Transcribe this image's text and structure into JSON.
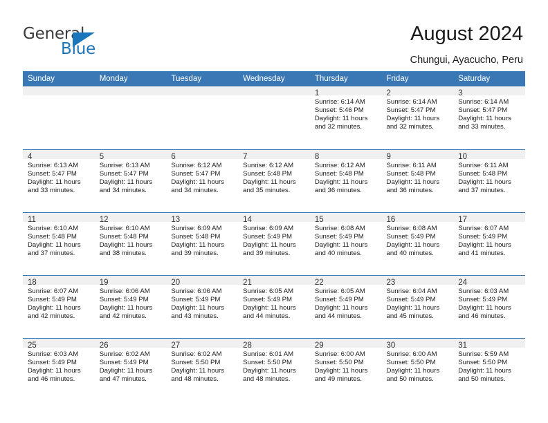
{
  "brand": {
    "name_part1": "General",
    "name_part2": "Blue"
  },
  "header": {
    "title": "August 2024",
    "location": "Chungui, Ayacucho, Peru"
  },
  "calendar": {
    "weekday_headers": [
      "Sunday",
      "Monday",
      "Tuesday",
      "Wednesday",
      "Thursday",
      "Friday",
      "Saturday"
    ],
    "colors": {
      "header_background": "#3a78b5",
      "header_text": "#ffffff",
      "daynum_background": "#f0f0f0",
      "row_border": "#3a78b5",
      "brand_blue": "#1b75bb"
    },
    "labels": {
      "sunrise": "Sunrise:",
      "sunset": "Sunset:",
      "daylight": "Daylight:"
    },
    "weeks": [
      [
        {
          "day": "",
          "empty": true
        },
        {
          "day": "",
          "empty": true
        },
        {
          "day": "",
          "empty": true
        },
        {
          "day": "",
          "empty": true
        },
        {
          "day": "1",
          "sunrise": "Sunrise: 6:14 AM",
          "sunset": "Sunset: 5:46 PM",
          "daylight": "Daylight: 11 hours and 32 minutes."
        },
        {
          "day": "2",
          "sunrise": "Sunrise: 6:14 AM",
          "sunset": "Sunset: 5:47 PM",
          "daylight": "Daylight: 11 hours and 32 minutes."
        },
        {
          "day": "3",
          "sunrise": "Sunrise: 6:14 AM",
          "sunset": "Sunset: 5:47 PM",
          "daylight": "Daylight: 11 hours and 33 minutes."
        }
      ],
      [
        {
          "day": "4",
          "sunrise": "Sunrise: 6:13 AM",
          "sunset": "Sunset: 5:47 PM",
          "daylight": "Daylight: 11 hours and 33 minutes."
        },
        {
          "day": "5",
          "sunrise": "Sunrise: 6:13 AM",
          "sunset": "Sunset: 5:47 PM",
          "daylight": "Daylight: 11 hours and 34 minutes."
        },
        {
          "day": "6",
          "sunrise": "Sunrise: 6:12 AM",
          "sunset": "Sunset: 5:47 PM",
          "daylight": "Daylight: 11 hours and 34 minutes."
        },
        {
          "day": "7",
          "sunrise": "Sunrise: 6:12 AM",
          "sunset": "Sunset: 5:48 PM",
          "daylight": "Daylight: 11 hours and 35 minutes."
        },
        {
          "day": "8",
          "sunrise": "Sunrise: 6:12 AM",
          "sunset": "Sunset: 5:48 PM",
          "daylight": "Daylight: 11 hours and 36 minutes."
        },
        {
          "day": "9",
          "sunrise": "Sunrise: 6:11 AM",
          "sunset": "Sunset: 5:48 PM",
          "daylight": "Daylight: 11 hours and 36 minutes."
        },
        {
          "day": "10",
          "sunrise": "Sunrise: 6:11 AM",
          "sunset": "Sunset: 5:48 PM",
          "daylight": "Daylight: 11 hours and 37 minutes."
        }
      ],
      [
        {
          "day": "11",
          "sunrise": "Sunrise: 6:10 AM",
          "sunset": "Sunset: 5:48 PM",
          "daylight": "Daylight: 11 hours and 37 minutes."
        },
        {
          "day": "12",
          "sunrise": "Sunrise: 6:10 AM",
          "sunset": "Sunset: 5:48 PM",
          "daylight": "Daylight: 11 hours and 38 minutes."
        },
        {
          "day": "13",
          "sunrise": "Sunrise: 6:09 AM",
          "sunset": "Sunset: 5:48 PM",
          "daylight": "Daylight: 11 hours and 39 minutes."
        },
        {
          "day": "14",
          "sunrise": "Sunrise: 6:09 AM",
          "sunset": "Sunset: 5:49 PM",
          "daylight": "Daylight: 11 hours and 39 minutes."
        },
        {
          "day": "15",
          "sunrise": "Sunrise: 6:08 AM",
          "sunset": "Sunset: 5:49 PM",
          "daylight": "Daylight: 11 hours and 40 minutes."
        },
        {
          "day": "16",
          "sunrise": "Sunrise: 6:08 AM",
          "sunset": "Sunset: 5:49 PM",
          "daylight": "Daylight: 11 hours and 40 minutes."
        },
        {
          "day": "17",
          "sunrise": "Sunrise: 6:07 AM",
          "sunset": "Sunset: 5:49 PM",
          "daylight": "Daylight: 11 hours and 41 minutes."
        }
      ],
      [
        {
          "day": "18",
          "sunrise": "Sunrise: 6:07 AM",
          "sunset": "Sunset: 5:49 PM",
          "daylight": "Daylight: 11 hours and 42 minutes."
        },
        {
          "day": "19",
          "sunrise": "Sunrise: 6:06 AM",
          "sunset": "Sunset: 5:49 PM",
          "daylight": "Daylight: 11 hours and 42 minutes."
        },
        {
          "day": "20",
          "sunrise": "Sunrise: 6:06 AM",
          "sunset": "Sunset: 5:49 PM",
          "daylight": "Daylight: 11 hours and 43 minutes."
        },
        {
          "day": "21",
          "sunrise": "Sunrise: 6:05 AM",
          "sunset": "Sunset: 5:49 PM",
          "daylight": "Daylight: 11 hours and 44 minutes."
        },
        {
          "day": "22",
          "sunrise": "Sunrise: 6:05 AM",
          "sunset": "Sunset: 5:49 PM",
          "daylight": "Daylight: 11 hours and 44 minutes."
        },
        {
          "day": "23",
          "sunrise": "Sunrise: 6:04 AM",
          "sunset": "Sunset: 5:49 PM",
          "daylight": "Daylight: 11 hours and 45 minutes."
        },
        {
          "day": "24",
          "sunrise": "Sunrise: 6:03 AM",
          "sunset": "Sunset: 5:49 PM",
          "daylight": "Daylight: 11 hours and 46 minutes."
        }
      ],
      [
        {
          "day": "25",
          "sunrise": "Sunrise: 6:03 AM",
          "sunset": "Sunset: 5:49 PM",
          "daylight": "Daylight: 11 hours and 46 minutes."
        },
        {
          "day": "26",
          "sunrise": "Sunrise: 6:02 AM",
          "sunset": "Sunset: 5:49 PM",
          "daylight": "Daylight: 11 hours and 47 minutes."
        },
        {
          "day": "27",
          "sunrise": "Sunrise: 6:02 AM",
          "sunset": "Sunset: 5:50 PM",
          "daylight": "Daylight: 11 hours and 48 minutes."
        },
        {
          "day": "28",
          "sunrise": "Sunrise: 6:01 AM",
          "sunset": "Sunset: 5:50 PM",
          "daylight": "Daylight: 11 hours and 48 minutes."
        },
        {
          "day": "29",
          "sunrise": "Sunrise: 6:00 AM",
          "sunset": "Sunset: 5:50 PM",
          "daylight": "Daylight: 11 hours and 49 minutes."
        },
        {
          "day": "30",
          "sunrise": "Sunrise: 6:00 AM",
          "sunset": "Sunset: 5:50 PM",
          "daylight": "Daylight: 11 hours and 50 minutes."
        },
        {
          "day": "31",
          "sunrise": "Sunrise: 5:59 AM",
          "sunset": "Sunset: 5:50 PM",
          "daylight": "Daylight: 11 hours and 50 minutes."
        }
      ]
    ]
  }
}
